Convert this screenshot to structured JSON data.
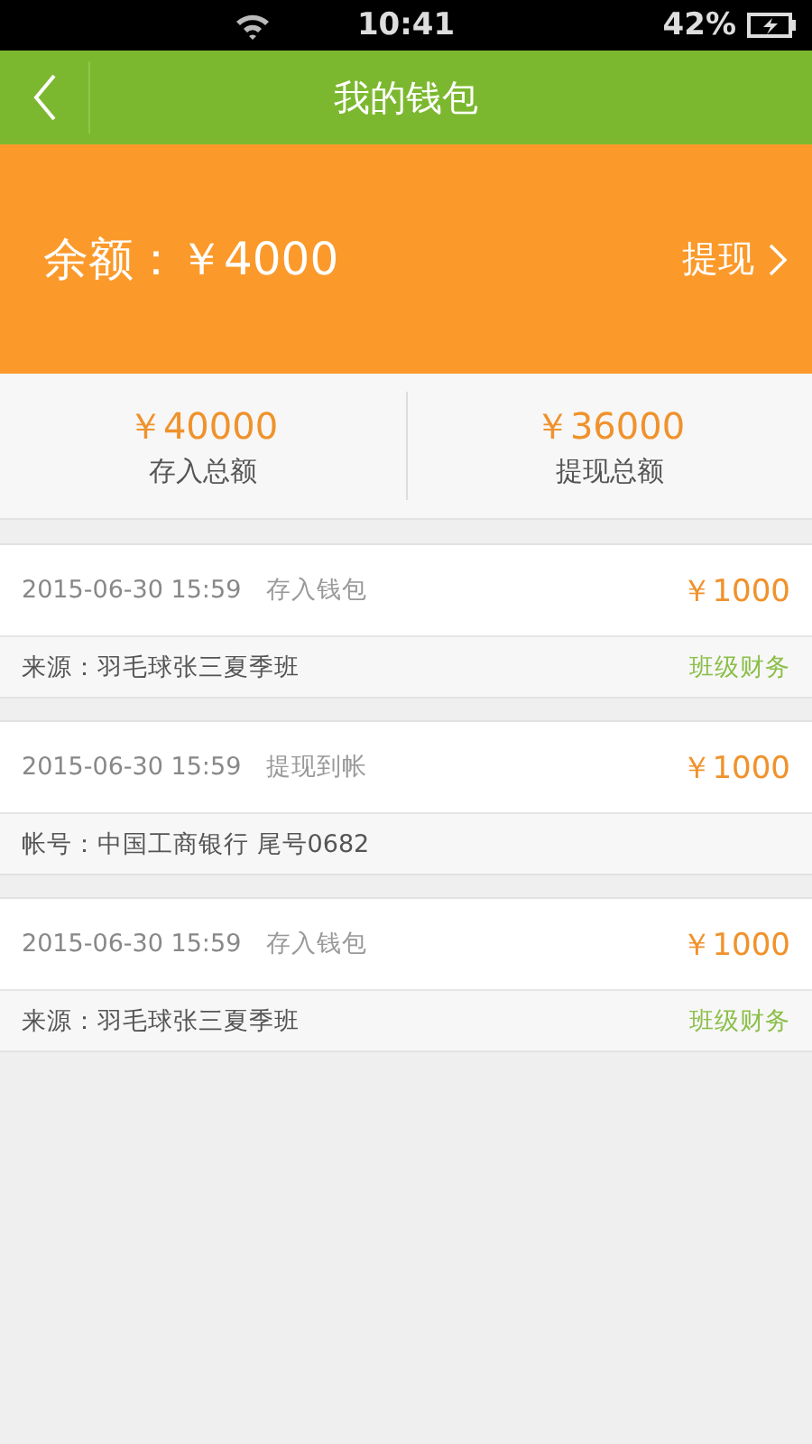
{
  "status_bar": {
    "time": "10:41",
    "battery": "42%"
  },
  "header": {
    "title": "我的钱包"
  },
  "balance": {
    "label": "余额：￥4000",
    "action": "提现"
  },
  "totals": [
    {
      "amount": "￥40000",
      "label": "存入总额"
    },
    {
      "amount": "￥36000",
      "label": "提现总额"
    }
  ],
  "records": [
    {
      "datetime": "2015-06-30 15:59",
      "type": "存入钱包",
      "amount": "￥1000",
      "detail": "来源：羽毛球张三夏季班",
      "tag": "班级财务"
    },
    {
      "datetime": "2015-06-30 15:59",
      "type": "提现到帐",
      "amount": "￥1000",
      "detail": "帐号：中国工商银行 尾号0682"
    },
    {
      "datetime": "2015-06-30 15:59",
      "type": "存入钱包",
      "amount": "￥1000",
      "detail": "来源：羽毛球张三夏季班",
      "tag": "班级财务"
    }
  ]
}
